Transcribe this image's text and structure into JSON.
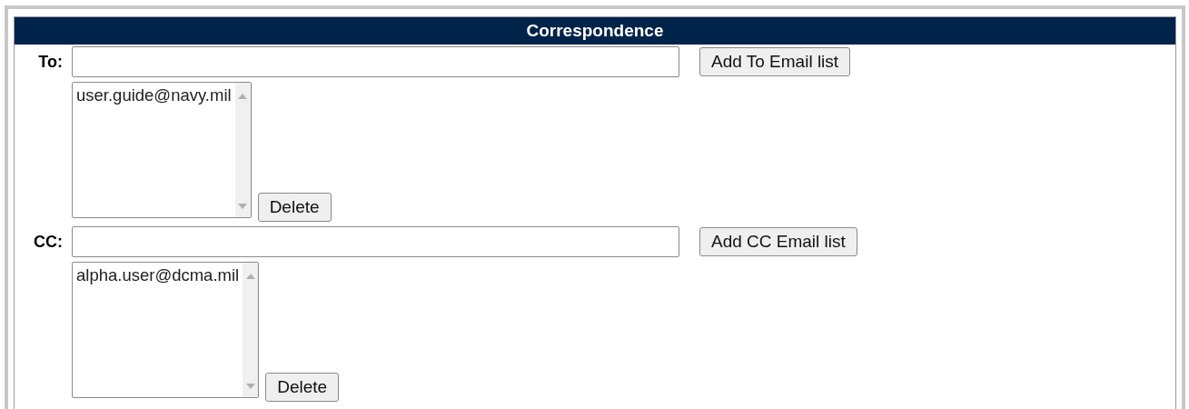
{
  "header": {
    "title": "Correspondence"
  },
  "sections": [
    {
      "label": "To:",
      "add_button": "Add To Email list",
      "emails": [
        "user.guide@navy.mil"
      ],
      "delete_button": "Delete"
    },
    {
      "label": "CC:",
      "add_button": "Add CC Email list",
      "emails": [
        "alpha.user@dcma.mil"
      ],
      "delete_button": "Delete"
    }
  ]
}
